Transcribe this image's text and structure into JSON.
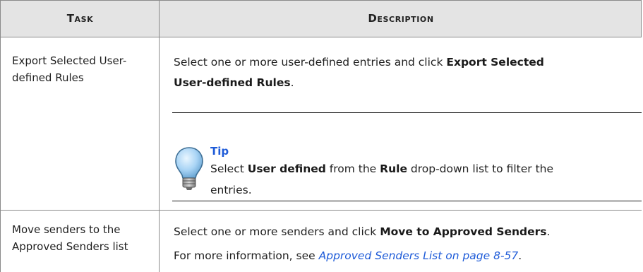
{
  "table": {
    "header": {
      "task": "Task",
      "description": "Description"
    },
    "rows": [
      {
        "task_line1": "Export Selected User-",
        "task_line2": "defined Rules",
        "desc_pre": "Select one or more user-defined entries and click ",
        "desc_bold1": "Export Selected",
        "desc_bold2": "User-defined Rules",
        "desc_post": ".",
        "tip": {
          "title": "Tip",
          "pre": "Select ",
          "bold1": "User defined",
          "mid": " from the ",
          "bold2": "Rule",
          "post": " drop-down list to filter the",
          "line2": "entries.",
          "icon": "lightbulb-icon"
        }
      },
      {
        "task_line1": "Move senders to the",
        "task_line2": "Approved Senders list",
        "desc_pre": "Select one or more senders and click ",
        "desc_bold": "Move to Approved Senders",
        "desc_post": ".",
        "more_pre": "For more information, see ",
        "more_link": "Approved Senders List on page 8-57",
        "more_post": "."
      }
    ]
  },
  "colors": {
    "header_bg": "#e4e4e4",
    "border": "#8a8a8a",
    "tip_title": "#1e5bd8",
    "link": "#1e5bd8",
    "bulb": "#a9d4f5"
  }
}
